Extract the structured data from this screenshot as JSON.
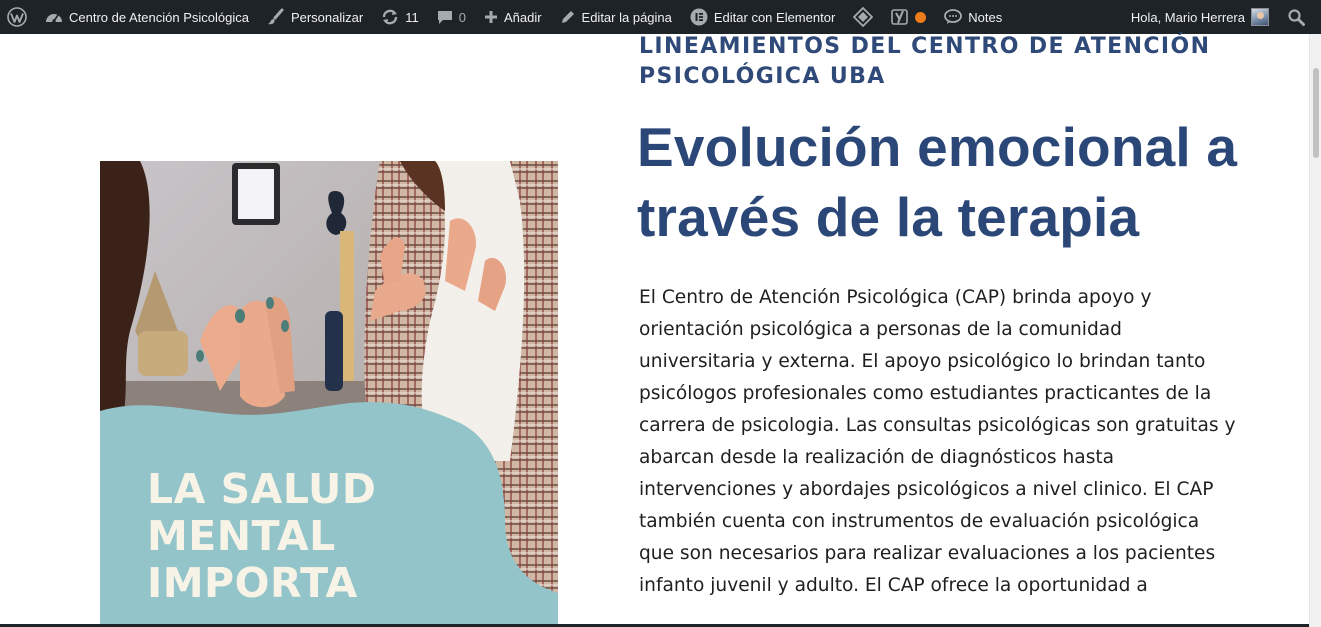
{
  "admin_bar": {
    "site_name": "Centro de Atención Psicológica",
    "customize": "Personalizar",
    "updates_count": "11",
    "comments_count": "0",
    "add_new": "Añadir",
    "edit_page": "Editar la página",
    "edit_elementor": "Editar con Elementor",
    "notes": "Notes",
    "greeting": "Hola, Mario Herrera",
    "icons": [
      "wordpress-icon",
      "dashboard-icon",
      "brush-icon",
      "updates-icon",
      "comment-icon",
      "plus-icon",
      "pencil-icon",
      "elementor-icon",
      "diamond-icon",
      "yoast-icon",
      "status-dot",
      "speech-bubble-icon",
      "avatar",
      "search-icon"
    ],
    "status_dot_color": "#ee7c1b"
  },
  "hero_card": {
    "headline": "LA SALUD\nMENTAL\nIMPORTA",
    "wave_color": "#92c4c9",
    "headline_color": "#f8f3e7"
  },
  "content": {
    "eyebrow": "LINEAMIENTOS DEL CENTRO DE ATENCIÓN PSICOLÓGICA UBA",
    "title": "Evolución emocional a través de la terapia",
    "body": "El Centro de Atención Psicológica (CAP) brinda apoyo y orientación psicológica a personas de la comunidad universitaria y externa. El apoyo psicológico lo brindan tanto psicólogos profesionales como estudiantes practicantes de la carrera de psicologia. Las consultas psicológicas son gratuitas y abarcan desde la realización de diagnósticos hasta intervenciones y abordajes psicológicos a nivel clinico. El CAP también cuenta con instrumentos de evaluación psicológica que son necesarios para realizar evaluaciones a los pacientes infanto juvenil y adulto. El CAP ofrece la oportunidad a",
    "title_color": "#2b4778"
  }
}
